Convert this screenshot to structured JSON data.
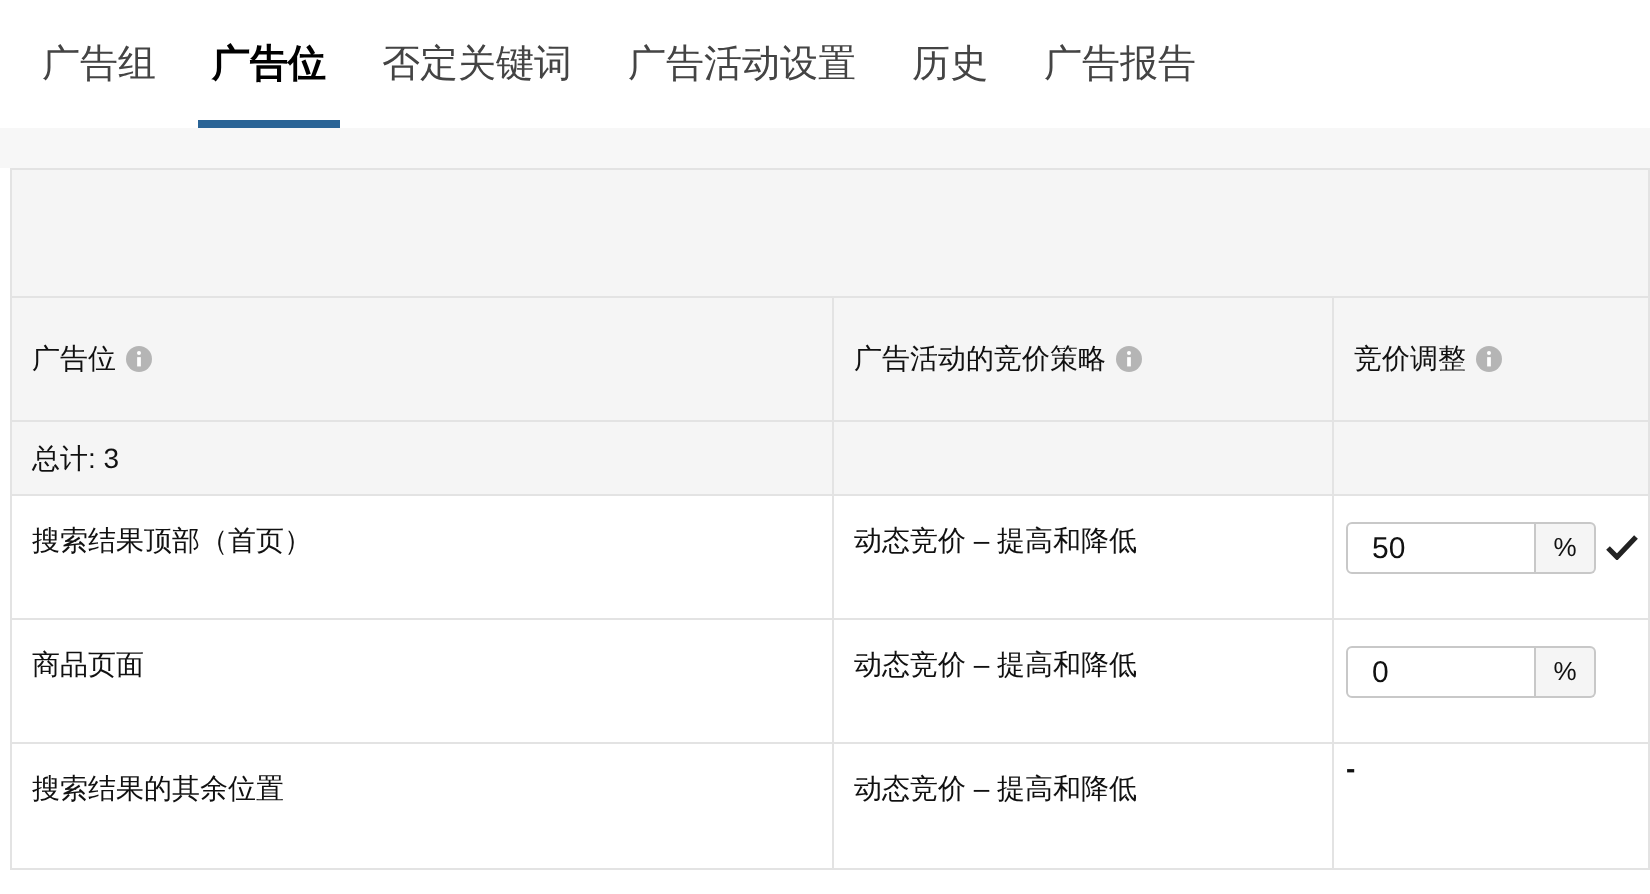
{
  "tabs": [
    {
      "label": "广告组",
      "selected": false
    },
    {
      "label": "广告位",
      "selected": true
    },
    {
      "label": "否定关键词",
      "selected": false
    },
    {
      "label": "广告活动设置",
      "selected": false
    },
    {
      "label": "历史",
      "selected": false
    },
    {
      "label": "广告报告",
      "selected": false
    }
  ],
  "table": {
    "columns": [
      "广告位",
      "广告活动的竞价策略",
      "竞价调整"
    ],
    "total": "总计: 3",
    "rows": [
      {
        "placement": "搜索结果顶部（首页）",
        "strategy": "动态竞价 – 提高和降低",
        "adjustment": {
          "kind": "input",
          "value": "50",
          "unit": "%",
          "confirmed": true
        }
      },
      {
        "placement": "商品页面",
        "strategy": "动态竞价 – 提高和降低",
        "adjustment": {
          "kind": "input",
          "value": "0",
          "unit": "%",
          "confirmed": false
        }
      },
      {
        "placement": "搜索结果的其余位置",
        "strategy": "动态竞价 – 提高和降低",
        "adjustment": {
          "kind": "text",
          "text": "-"
        }
      }
    ]
  }
}
